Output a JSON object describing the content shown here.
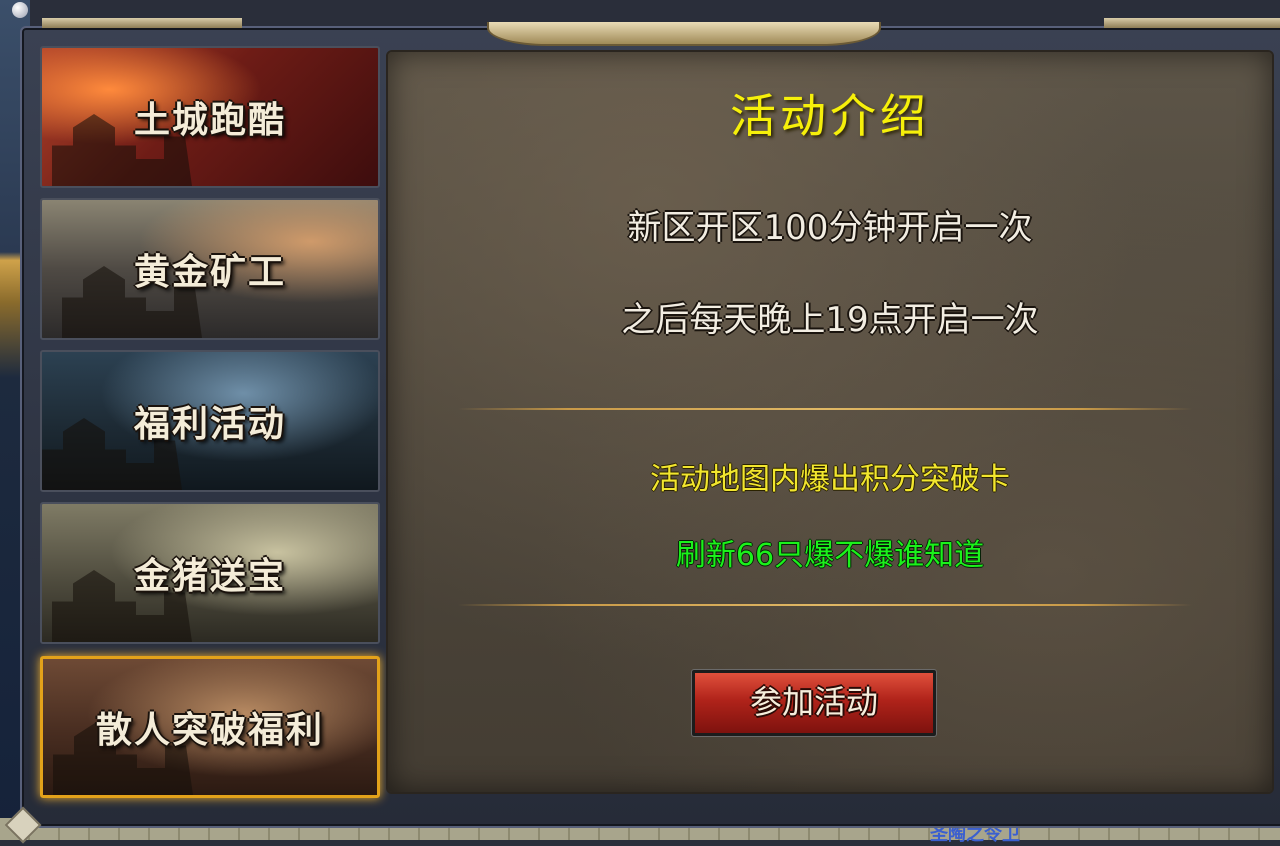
{
  "tabs": [
    {
      "label": "土城跑酷",
      "selected": false
    },
    {
      "label": "黄金矿工",
      "selected": false
    },
    {
      "label": "福利活动",
      "selected": false
    },
    {
      "label": "金猪送宝",
      "selected": false
    },
    {
      "label": "散人突破福利",
      "selected": true
    }
  ],
  "panel": {
    "title": "活动介绍",
    "line1": "新区开区100分钟开启一次",
    "line2": "之后每天晚上19点开启一次",
    "highlight_yellow": "活动地图内爆出积分突破卡",
    "highlight_green": "刷新66只爆不爆谁知道",
    "join_button": "参加活动"
  },
  "background": {
    "bottom_text": "圣陶之令卫"
  },
  "colors": {
    "title": "#f6f00a",
    "yellow_text": "#f2e62e",
    "green_text": "#1bf21b",
    "selected_border": "#e3a21a",
    "button": "#b0231a"
  }
}
